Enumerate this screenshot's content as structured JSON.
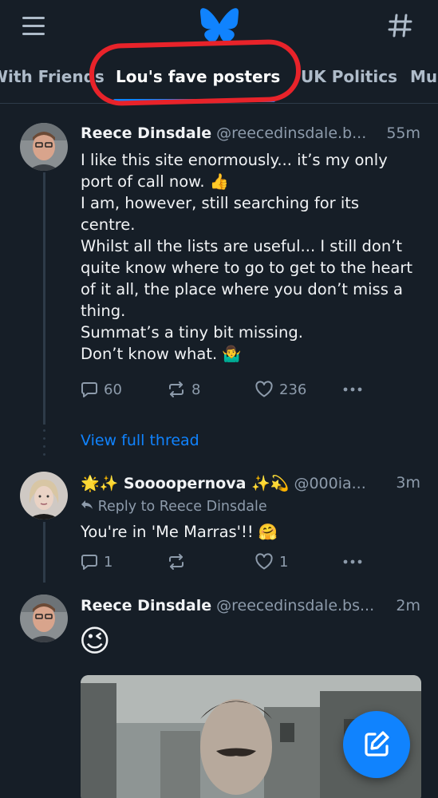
{
  "tabs": [
    "With Friends",
    "Lou's fave posters",
    "UK Politics",
    "Mu"
  ],
  "posts": [
    {
      "name": "Reece Dinsdale",
      "handle": "@reecedinsdale.b...",
      "time": "55m",
      "text": "I like this site enormously... it’s my only port of call now. 👍\nI am, however, still searching for its centre.\nWhilst all the lists are useful... I still don’t quite know where to go to get to the heart of it all, the place where you don’t miss a thing.\nSummat’s a tiny bit missing.\nDon’t know what. 🤷‍♂️",
      "replies": "60",
      "reposts": "8",
      "likes": "236"
    },
    {
      "name": "🌟✨ Soooopernova ✨💫",
      "handle": "@000ia...",
      "time": "3m",
      "reply_to": "Reply to Reece Dinsdale",
      "text": "You're in 'Me Marras'!! 🤗",
      "replies": "1",
      "likes": "1"
    },
    {
      "name": "Reece Dinsdale",
      "handle": "@reecedinsdale.bs...",
      "time": "2m",
      "text": "😉"
    }
  ],
  "view_full_thread": "View full thread",
  "colors": {
    "background": "#161e27",
    "accent": "#1083fe",
    "muted": "#8d9bab",
    "annotation": "#e8232a"
  },
  "icons": {
    "menu": "hamburger-icon",
    "logo": "butterfly-logo",
    "feeds": "hash-icon",
    "reply": "speech-bubble-icon",
    "repost": "repost-icon",
    "like": "heart-icon",
    "more": "ellipsis-icon",
    "compose": "compose-icon"
  }
}
